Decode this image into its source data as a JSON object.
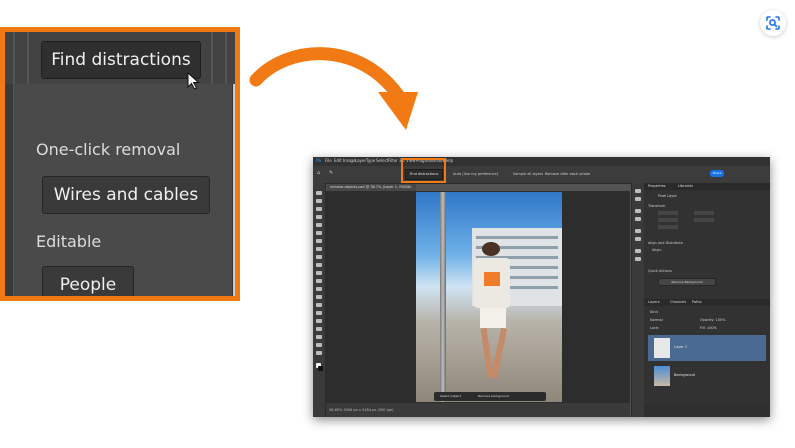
{
  "callout": {
    "find_distractions": "Find distractions",
    "one_click_label": "One-click removal",
    "wires_button": "Wires and cables",
    "editable_label": "Editable",
    "people_button": "People"
  },
  "photoshop": {
    "menu": [
      "PS",
      "File",
      "Edit",
      "Image",
      "Layer",
      "Type",
      "Select",
      "Filter",
      "3D",
      "View",
      "Plugins",
      "Window",
      "Help"
    ],
    "options": {
      "find_distractions": "Find distractions",
      "mode": "Auto (Use my preference)",
      "sample_all": "Sample all layers",
      "remove_after": "Remove after each stroke",
      "share": "Share"
    },
    "doc_tab": "remove-objects.psd @ 38.7% (Layer 1, RGB/8)",
    "context_bar": {
      "select_subject": "Select subject",
      "remove_background": "Remove background"
    },
    "status": "38.65%   3456 px x 5184 px (300 ppi)",
    "panel": {
      "tabs": [
        "Properties",
        "Libraries"
      ],
      "pixel_layer": "Pixel Layer",
      "transform": "Transform",
      "align": "Align and Distribute",
      "align_sub": "Align:",
      "quick_actions": "Quick Actions",
      "remove_bg": "Remove Background",
      "layer_tabs": [
        "Layers",
        "Channels",
        "Paths"
      ],
      "kind": "Kind",
      "normal": "Normal",
      "opacity": "Opacity: 100%",
      "lock": "Lock:",
      "fill": "Fill: 100%",
      "layers": [
        "Layer 1",
        "Background"
      ]
    }
  },
  "colors": {
    "highlight": "#f27a15",
    "share_blue": "#1473e6"
  },
  "icons": [
    "pointer-cursor-icon",
    "curved-arrow-icon",
    "lens-search-icon"
  ]
}
